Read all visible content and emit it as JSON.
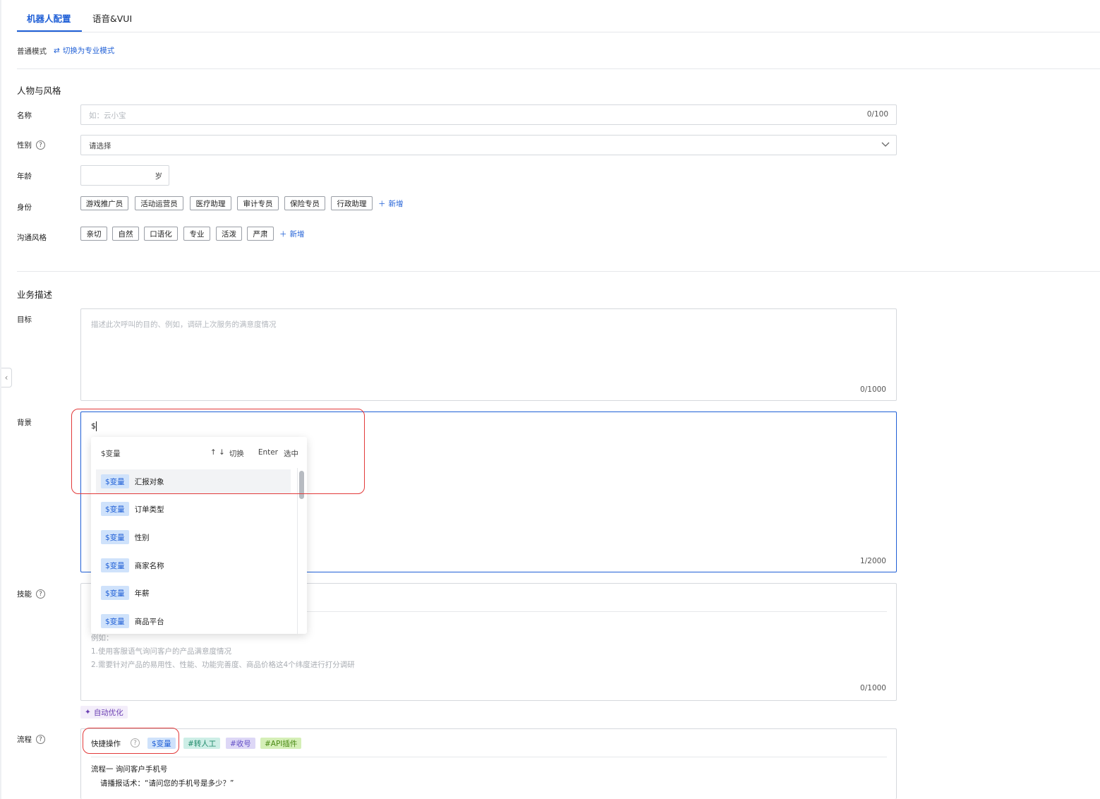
{
  "tabs": [
    {
      "label": "机器人配置",
      "active": true
    },
    {
      "label": "语音&VUI",
      "active": false
    }
  ],
  "mode": {
    "label": "普通模式",
    "switch_icon": "swap-icon",
    "switch_text": "切换为专业模式"
  },
  "persona": {
    "title": "人物与风格",
    "name": {
      "label": "名称",
      "placeholder": "如：云小宝",
      "counter": "0/100"
    },
    "gender": {
      "label": "性别",
      "placeholder": "请选择"
    },
    "age": {
      "label": "年龄",
      "unit": "岁"
    },
    "identity": {
      "label": "身份",
      "tags": [
        "游戏推广员",
        "活动运营员",
        "医疗助理",
        "审计专员",
        "保险专员",
        "行政助理"
      ],
      "add": "新增"
    },
    "style": {
      "label": "沟通风格",
      "tags": [
        "亲切",
        "自然",
        "口语化",
        "专业",
        "活泼",
        "严肃"
      ],
      "add": "新增"
    }
  },
  "business": {
    "title": "业务描述",
    "goal": {
      "label": "目标",
      "placeholder": "描述此次呼叫的目的、例如，调研上次服务的满意度情况",
      "counter": "0/1000"
    },
    "background": {
      "label": "背景",
      "value": "$",
      "counter": "1/2000"
    },
    "skills": {
      "label": "技能",
      "example_title": "例如：",
      "example_1": "1.使用客服语气询问客户的产品满意度情况",
      "example_2": "2.需要针对产品的易用性、性能、功能完善度、商品价格这4个纬度进行打分调研",
      "counter": "0/1000",
      "auto_optimize": "自动优化"
    },
    "flow": {
      "label": "流程",
      "quick_ops": "快捷操作",
      "qa_tags": [
        "$变量",
        "#转人工",
        "#收号",
        "#API插件"
      ],
      "line1": "流程一 询问客户手机号",
      "line2": "请播报话术：“请问您的手机号是多少？”"
    }
  },
  "dropdown": {
    "header": "$变量",
    "hint_arrows": "↑ ↓",
    "hint_switch": "切换",
    "hint_enter": "Enter",
    "hint_select": "选中",
    "badge": "$变量",
    "items": [
      "汇报对象",
      "订单类型",
      "性别",
      "商家名称",
      "年薪",
      "商品平台"
    ]
  },
  "colors": {
    "accent": "#1f5fd6",
    "highlight_box": "#e23a3a"
  }
}
